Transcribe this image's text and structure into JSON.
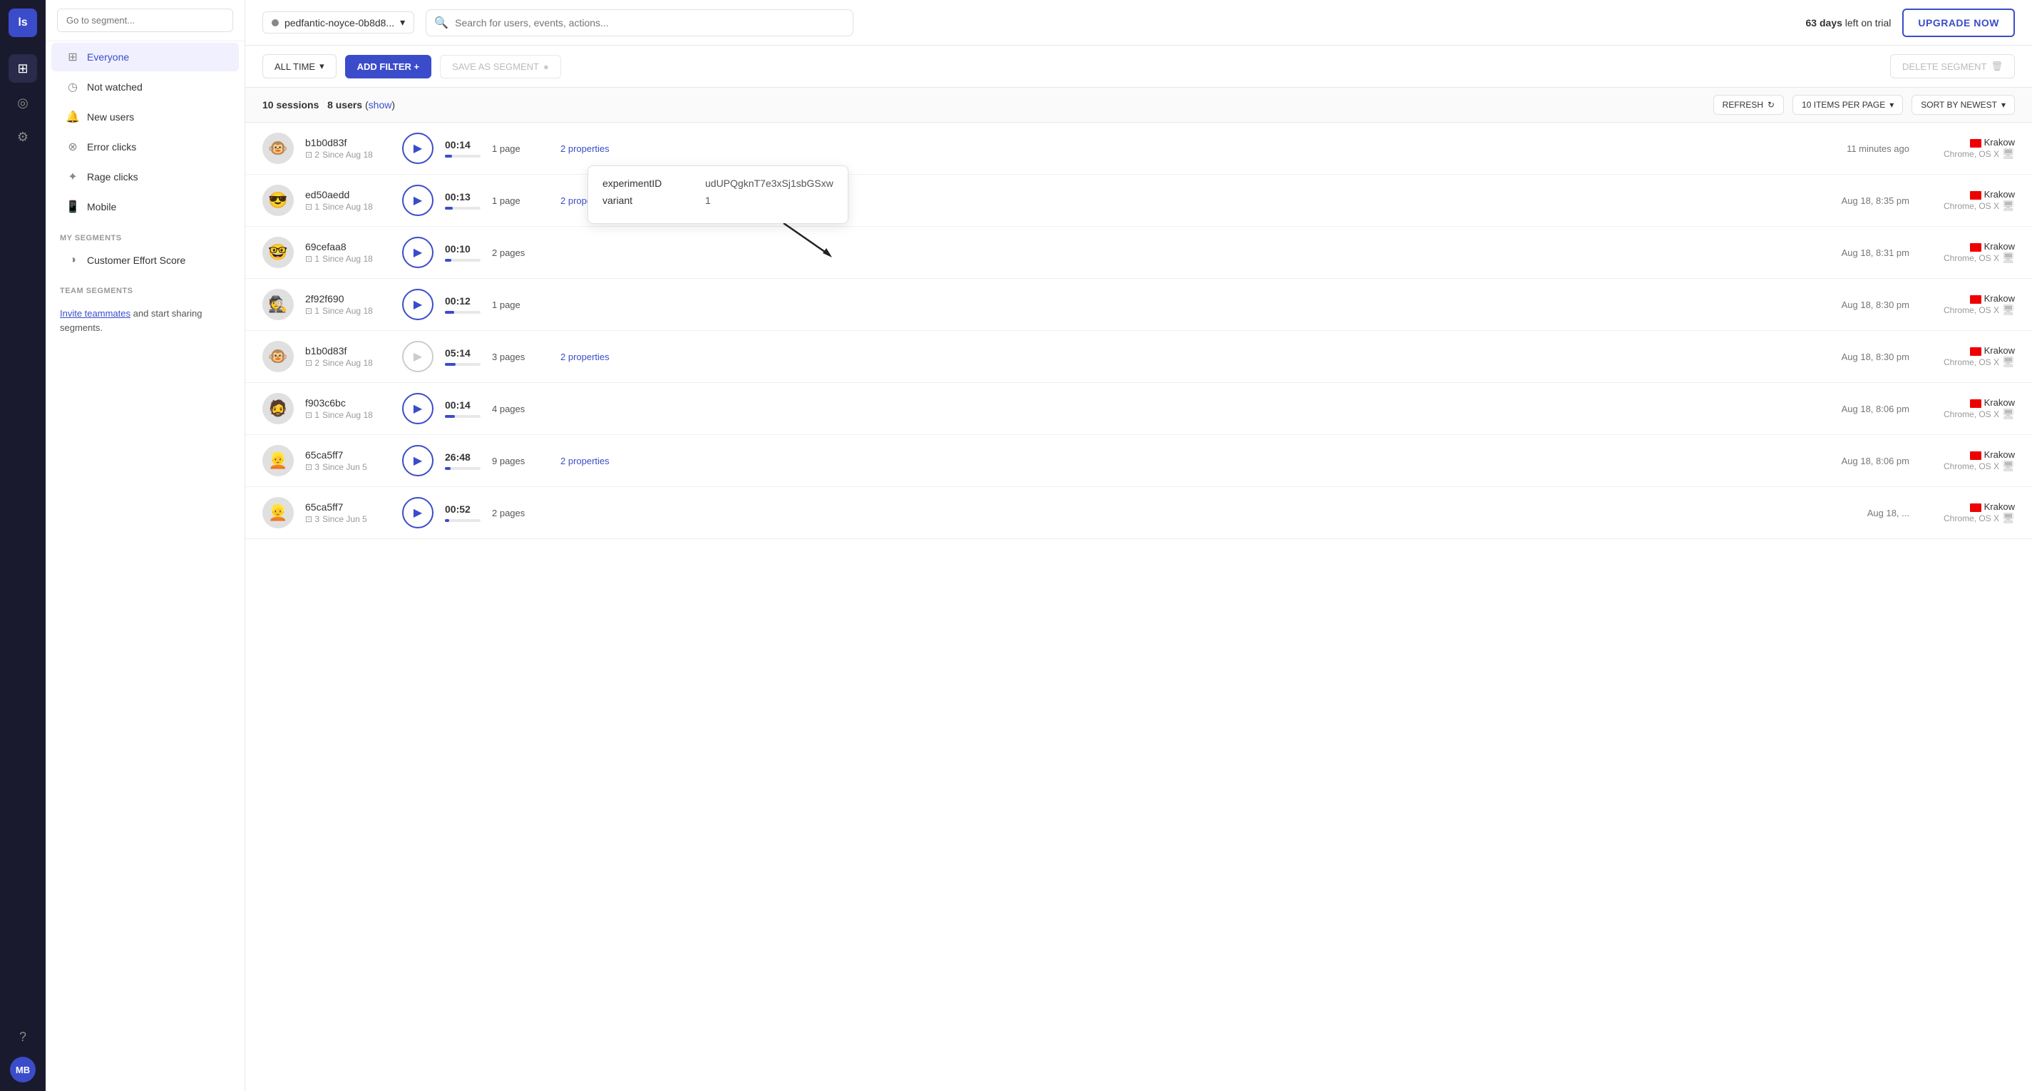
{
  "iconbar": {
    "logo": "ls",
    "avatar": "MB"
  },
  "sidebar": {
    "search_placeholder": "Go to segment...",
    "nav_items": [
      {
        "id": "everyone",
        "label": "Everyone",
        "icon": "⊞",
        "active": true
      },
      {
        "id": "not-watched",
        "label": "Not watched",
        "icon": "◷"
      },
      {
        "id": "new-users",
        "label": "New users",
        "icon": "🔔"
      },
      {
        "id": "error-clicks",
        "label": "Error clicks",
        "icon": "⊗"
      },
      {
        "id": "rage-clicks",
        "label": "Rage clicks",
        "icon": "✦"
      },
      {
        "id": "mobile",
        "label": "Mobile",
        "icon": "📱"
      }
    ],
    "my_segments_title": "MY SEGMENTS",
    "my_segments": [
      {
        "id": "customer-effort-score",
        "label": "Customer Effort Score",
        "icon": "◑"
      }
    ],
    "team_segments_title": "TEAM SEGMENTS",
    "invite_text_prefix": "Invite teammates",
    "invite_text_suffix": " and start sharing segments."
  },
  "topbar": {
    "workspace": "pedfantic-noyce-0b8d8...",
    "search_placeholder": "Search for users, events, actions...",
    "trial_days": "63 days",
    "trial_label": " left on trial",
    "upgrade_label": "UPGRADE NOW"
  },
  "filter_bar": {
    "all_time_label": "ALL TIME",
    "add_filter_label": "ADD FILTER +",
    "save_segment_label": "SAVE AS SEGMENT",
    "delete_segment_label": "DELETE SEGMENT"
  },
  "sessions_bar": {
    "count": "10 sessions",
    "users": "8 users",
    "show_label": "show",
    "refresh_label": "REFRESH",
    "items_per_page_label": "10 ITEMS PER PAGE",
    "sort_label": "SORT BY NEWEST"
  },
  "tooltip": {
    "key1": "experimentID",
    "val1": "udUPQgknT7e3xSj1sbGSxw",
    "key2": "variant",
    "val2": "1"
  },
  "sessions": [
    {
      "id": "b1b0d83f",
      "avatar": "🐵",
      "sessions": "2",
      "since": "Since Aug 18",
      "duration": "00:14",
      "pages": "1 page",
      "properties": "2 properties",
      "progress": 20,
      "time": "11 minutes ago",
      "location": "Krakow",
      "browser": "Chrome, OS X",
      "play_active": true
    },
    {
      "id": "ed50aedd",
      "avatar": "😎",
      "sessions": "1",
      "since": "Since Aug 18",
      "duration": "00:13",
      "pages": "1 page",
      "properties": "2 properties",
      "progress": 22,
      "time": "Aug 18, 8:35 pm",
      "location": "Krakow",
      "browser": "Chrome, OS X",
      "play_active": true
    },
    {
      "id": "69cefaa8",
      "avatar": "🤓",
      "sessions": "1",
      "since": "Since Aug 18",
      "duration": "00:10",
      "pages": "2 pages",
      "properties": "",
      "progress": 18,
      "time": "Aug 18, 8:31 pm",
      "location": "Krakow",
      "browser": "Chrome, OS X",
      "play_active": true
    },
    {
      "id": "2f92f690",
      "avatar": "🕵️",
      "sessions": "1",
      "since": "Since Aug 18",
      "duration": "00:12",
      "pages": "1 page",
      "properties": "",
      "progress": 25,
      "time": "Aug 18, 8:30 pm",
      "location": "Krakow",
      "browser": "Chrome, OS X",
      "play_active": true
    },
    {
      "id": "b1b0d83f",
      "avatar": "🐵",
      "sessions": "2",
      "since": "Since Aug 18",
      "duration": "05:14",
      "pages": "3 pages",
      "properties": "2 properties",
      "progress": 30,
      "time": "Aug 18, 8:30 pm",
      "location": "Krakow",
      "browser": "Chrome, OS X",
      "play_active": false
    },
    {
      "id": "f903c6bc",
      "avatar": "🧔",
      "sessions": "1",
      "since": "Since Aug 18",
      "duration": "00:14",
      "pages": "4 pages",
      "properties": "",
      "progress": 28,
      "time": "Aug 18, 8:06 pm",
      "location": "Krakow",
      "browser": "Chrome, OS X",
      "play_active": true
    },
    {
      "id": "65ca5ff7",
      "avatar": "👱",
      "sessions": "3",
      "since": "Since Jun 5",
      "duration": "26:48",
      "pages": "9 pages",
      "properties": "2 properties",
      "progress": 15,
      "time": "Aug 18, 8:06 pm",
      "location": "Krakow",
      "browser": "Chrome, OS X",
      "play_active": true
    },
    {
      "id": "65ca5ff7",
      "avatar": "👱",
      "sessions": "3",
      "since": "Since Jun 5",
      "duration": "00:52",
      "pages": "2 pages",
      "properties": "",
      "progress": 12,
      "time": "Aug 18, ...",
      "location": "Krakow",
      "browser": "Chrome, OS X",
      "play_active": true
    }
  ]
}
